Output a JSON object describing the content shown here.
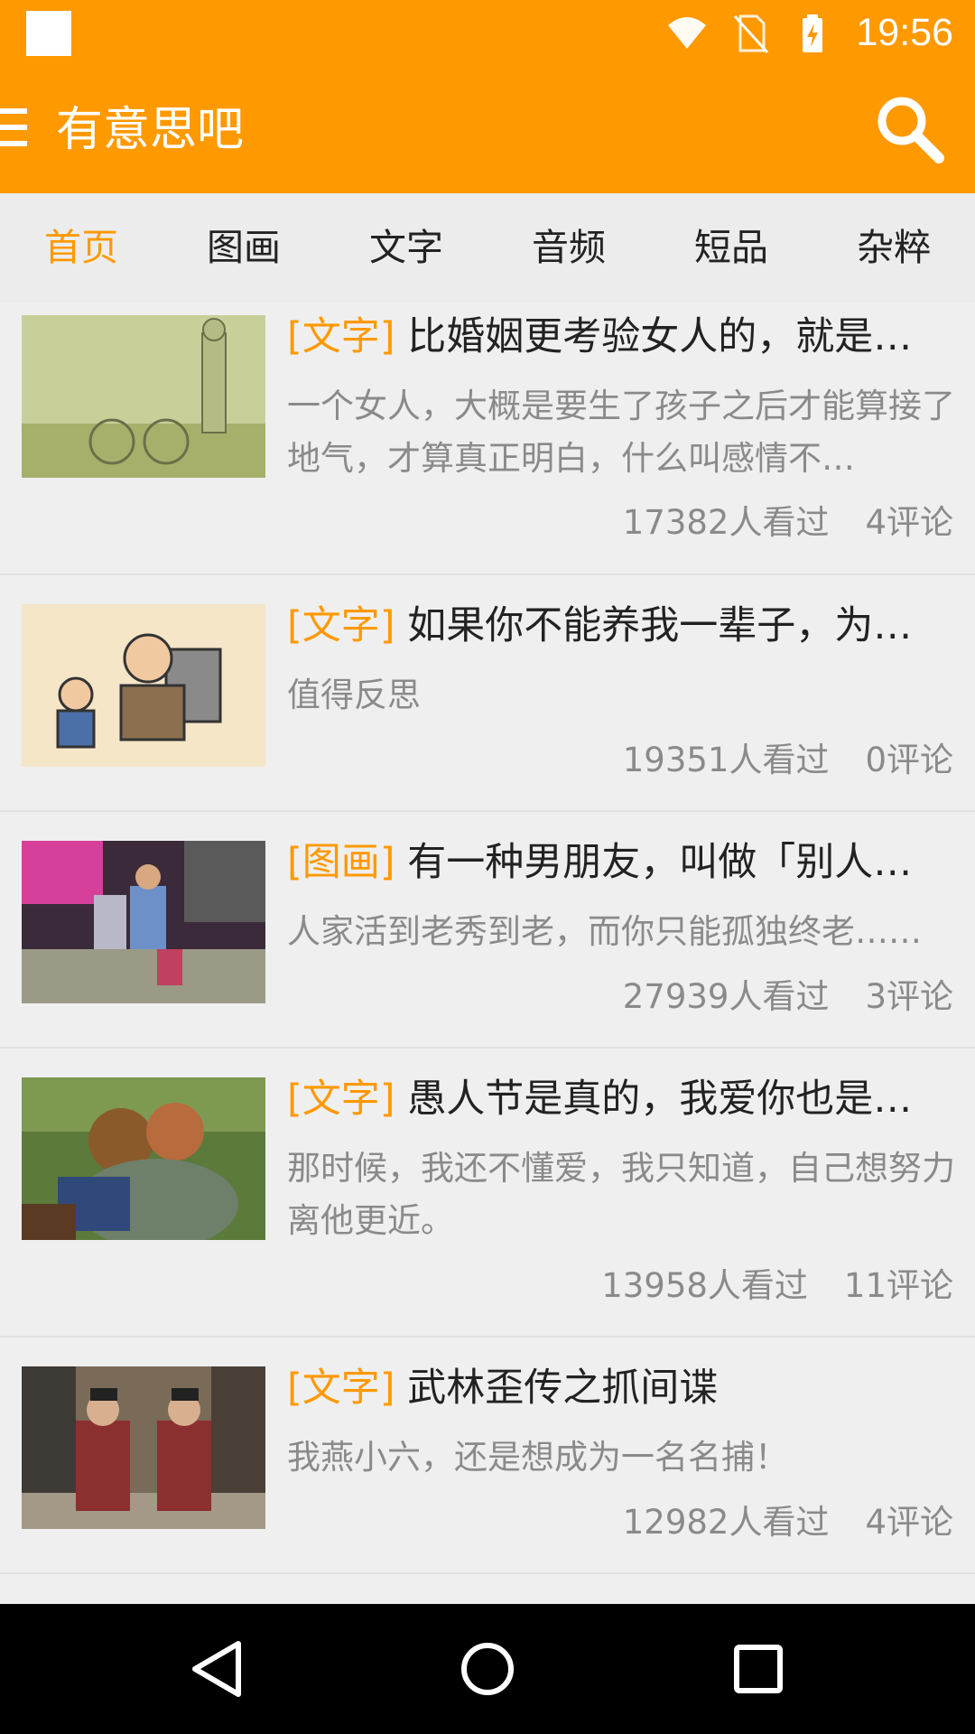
{
  "status_bar": {
    "time": "19:56",
    "icons": [
      "app-notification-icon",
      "wifi-icon",
      "no-sim-icon",
      "battery-charging-icon"
    ]
  },
  "app_bar": {
    "title": "有意思吧",
    "menu_icon": "menu-icon",
    "search_icon": "search-icon"
  },
  "tabs": [
    {
      "label": "首页",
      "active": true
    },
    {
      "label": "图画",
      "active": false
    },
    {
      "label": "文字",
      "active": false
    },
    {
      "label": "音频",
      "active": false
    },
    {
      "label": "短品",
      "active": false
    },
    {
      "label": "杂粹",
      "active": false
    }
  ],
  "articles": [
    {
      "tag": "[文字]",
      "title": "比婚姻更考验女人的，就是…",
      "desc": "一个女人，大概是要生了孩子之后才能算接了地气，才算真正明白，什么叫感情不…",
      "views": "17382人看过",
      "comments": "4评论"
    },
    {
      "tag": "[文字]",
      "title": "如果你不能养我一辈子，为…",
      "desc": "值得反思",
      "views": "19351人看过",
      "comments": "0评论"
    },
    {
      "tag": "[图画]",
      "title": "有一种男朋友，叫做「别人…",
      "desc": "人家活到老秀到老，而你只能孤独终老……",
      "views": "27939人看过",
      "comments": "3评论"
    },
    {
      "tag": "[文字]",
      "title": "愚人节是真的，我爱你也是…",
      "desc": "那时候，我还不懂爱，我只知道，自己想努力离他更近。",
      "views": "13958人看过",
      "comments": "11评论"
    },
    {
      "tag": "[文字]",
      "title": "武林歪传之抓间谍",
      "desc": "我燕小六，还是想成为一名名捕！",
      "views": "12982人看过",
      "comments": "4评论"
    }
  ],
  "nav_bar": {
    "buttons": [
      "back-icon",
      "home-icon",
      "recents-icon"
    ]
  },
  "colors": {
    "accent": "#ff9900",
    "tab_bg": "#ececec",
    "list_bg": "#efefef",
    "nav_bg": "#000000"
  }
}
